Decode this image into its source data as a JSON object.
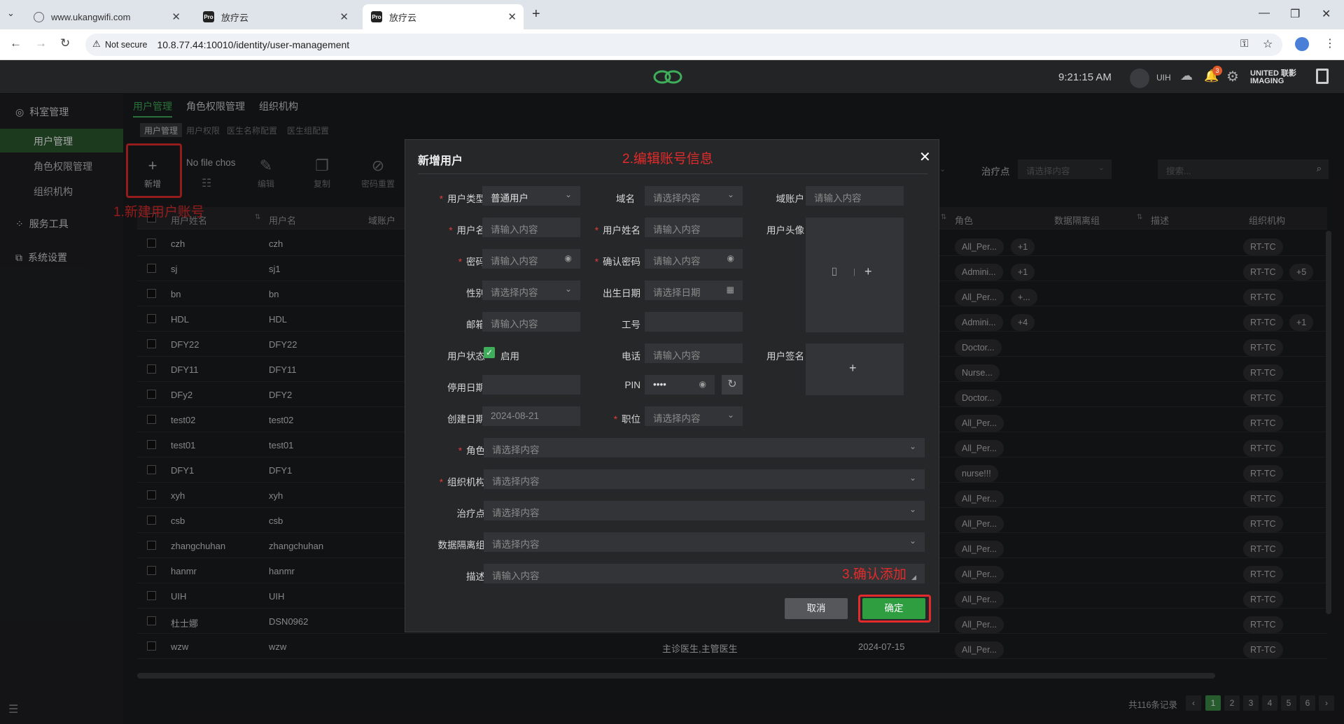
{
  "browser": {
    "tabs": [
      {
        "label": "www.ukangwifi.com"
      },
      {
        "label": "放疗云",
        "fav": "Pro"
      },
      {
        "label": "放疗云",
        "fav": "Pro"
      }
    ],
    "not_secure": "Not secure",
    "url": "10.8.77.44:10010/identity/user-management"
  },
  "header": {
    "time": "9:21:15 AM",
    "user": "UIH",
    "notif_count": "3",
    "brand_line1": "UNITED 联影",
    "brand_line2": "IMAGING"
  },
  "sidebar": {
    "groups": [
      {
        "label": "科室管理",
        "icon": "department-icon"
      },
      {
        "label": "服务工具",
        "icon": "tools-icon"
      },
      {
        "label": "系统设置",
        "icon": "settings-icon"
      }
    ],
    "items": [
      "用户管理",
      "角色权限管理",
      "组织机构"
    ]
  },
  "topnav": [
    "用户管理",
    "角色权限管理",
    "组织机构"
  ],
  "subtabs": [
    "用户管理",
    "用户权限",
    "医生名称配置",
    "医生组配置"
  ],
  "toolbar": {
    "add": "新增",
    "file": "No file chos",
    "edit": "编辑",
    "copy": "复制",
    "reset": "密码重置",
    "treatment_label": "治疗点",
    "treatment_placeholder": "请选择内容",
    "search_placeholder": "搜索..."
  },
  "table": {
    "headers": [
      "用户姓名",
      "用户名",
      "域账户",
      "角色",
      "数据隔离组",
      "描述",
      "组织机构"
    ],
    "rows": [
      {
        "name": "czh",
        "user": "czh",
        "role": "All_Per...",
        "extra": "+1",
        "org": "RT-TC",
        "orgx": ""
      },
      {
        "name": "sj",
        "user": "sj1",
        "role": "Admini...",
        "extra": "+1",
        "org": "RT-TC",
        "orgx": "+5"
      },
      {
        "name": "bn",
        "user": "bn",
        "role": "All_Per...",
        "extra": "+...",
        "org": "RT-TC",
        "orgx": ""
      },
      {
        "name": "HDL",
        "user": "HDL",
        "role": "Admini...",
        "extra": "+4",
        "org": "RT-TC",
        "orgx": "+1"
      },
      {
        "name": "DFY22",
        "user": "DFY22",
        "role": "Doctor...",
        "extra": "",
        "org": "RT-TC",
        "orgx": ""
      },
      {
        "name": "DFY11",
        "user": "DFY11",
        "role": "Nurse...",
        "extra": "",
        "org": "RT-TC",
        "orgx": ""
      },
      {
        "name": "DFy2",
        "user": "DFY2",
        "role": "Doctor...",
        "extra": "",
        "org": "RT-TC",
        "orgx": ""
      },
      {
        "name": "test02",
        "user": "test02",
        "role": "All_Per...",
        "extra": "",
        "org": "RT-TC",
        "orgx": ""
      },
      {
        "name": "test01",
        "user": "test01",
        "role": "All_Per...",
        "extra": "",
        "org": "RT-TC",
        "orgx": ""
      },
      {
        "name": "DFY1",
        "user": "DFY1",
        "role": "nurse!!!",
        "extra": "",
        "org": "RT-TC",
        "orgx": ""
      },
      {
        "name": "xyh",
        "user": "xyh",
        "role": "All_Per...",
        "extra": "",
        "org": "RT-TC",
        "orgx": ""
      },
      {
        "name": "csb",
        "user": "csb",
        "role": "All_Per...",
        "extra": "",
        "org": "RT-TC",
        "orgx": ""
      },
      {
        "name": "zhangchuhan",
        "user": "zhangchuhan",
        "role": "All_Per...",
        "extra": "",
        "org": "RT-TC",
        "orgx": ""
      },
      {
        "name": "hanmr",
        "user": "hanmr",
        "role": "All_Per...",
        "extra": "",
        "org": "RT-TC",
        "orgx": ""
      },
      {
        "name": "UIH",
        "user": "UIH",
        "role": "All_Per...",
        "extra": "",
        "org": "RT-TC",
        "orgx": ""
      },
      {
        "name": "杜士娜",
        "user": "DSN0962",
        "role": "All_Per...",
        "extra": "",
        "org": "RT-TC",
        "orgx": ""
      },
      {
        "name": "wzw",
        "user": "wzw",
        "role": "All_Per...",
        "extra": "",
        "org": "RT-TC",
        "orgx": "",
        "mid": "主诊医生,主管医生",
        "date": "2024-07-15"
      }
    ]
  },
  "pagination": {
    "total": "共116条记录",
    "pages": [
      "1",
      "2",
      "3",
      "4",
      "5",
      "6"
    ]
  },
  "annotations": {
    "step1": "1.新建用户账号",
    "step2": "2.编辑账号信息",
    "step3": "3.确认添加"
  },
  "modal": {
    "title": "新增用户",
    "user_type_label": "用户类型",
    "user_type_value": "普通用户",
    "domain_label": "域名",
    "domain_placeholder": "请选择内容",
    "domain_account_label": "域账户",
    "domain_account_placeholder": "请输入内容",
    "username_label": "用户名",
    "username_placeholder": "请输入内容",
    "fullname_label": "用户姓名",
    "fullname_placeholder": "请输入内容",
    "avatar_label": "用户头像",
    "password_label": "密码",
    "password_placeholder": "请输入内容",
    "confirm_label": "确认密码",
    "confirm_placeholder": "请输入内容",
    "gender_label": "性别",
    "gender_placeholder": "请选择内容",
    "birth_label": "出生日期",
    "birth_placeholder": "请选择日期",
    "email_label": "邮箱",
    "email_placeholder": "请输入内容",
    "jobno_label": "工号",
    "status_label": "用户状态",
    "status_value": "启用",
    "phone_label": "电话",
    "phone_placeholder": "请输入内容",
    "signature_label": "用户签名",
    "disable_label": "停用日期",
    "pin_label": "PIN",
    "pin_value": "••••",
    "created_label": "创建日期",
    "created_value": "2024-08-21",
    "position_label": "职位",
    "position_placeholder": "请选择内容",
    "role_label": "角色",
    "role_placeholder": "请选择内容",
    "org_label": "组织机构",
    "org_placeholder": "请选择内容",
    "treatment_label": "治疗点",
    "treatment_placeholder": "请选择内容",
    "isolation_label": "数据隔离组",
    "isolation_placeholder": "请选择内容",
    "desc_label": "描述",
    "desc_placeholder": "请输入内容",
    "cancel": "取消",
    "ok": "确定"
  }
}
